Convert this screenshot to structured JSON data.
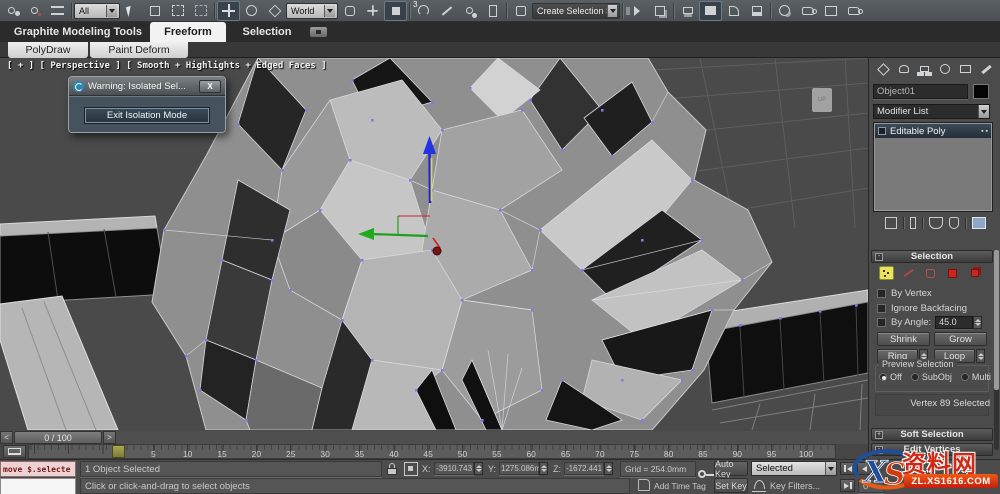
{
  "toolbar": {
    "selection_filter_value": "All",
    "reference_coordinate_value": "World",
    "named_selection_value": "Create Selection Se"
  },
  "ribbon": {
    "tab_gmt": "Graphite Modeling Tools",
    "tab_freeform": "Freeform",
    "tab_selection": "Selection",
    "subtab_polydraw": "PolyDraw",
    "subtab_paintdeform": "Paint Deform"
  },
  "viewport": {
    "label": "[ + ]  [ Perspective ]  [ Smooth + Highlights + Edged Faces ]",
    "up_cube": "UP"
  },
  "dialog": {
    "title": "Warning: Isolated Sel...",
    "close": "X",
    "exit_button": "Exit Isolation Mode"
  },
  "command_panel": {
    "object_name": "Object01",
    "modifier_list": "Modifier List",
    "stack_item": "Editable Poly",
    "selection": {
      "header": "Selection",
      "by_vertex": "By Vertex",
      "ignore_backfacing": "Ignore Backfacing",
      "by_angle": "By Angle:",
      "angle_value": "45.0",
      "shrink": "Shrink",
      "grow": "Grow",
      "ring": "Ring",
      "loop": "Loop",
      "preview_header": "Preview Selection",
      "radio_off": "Off",
      "radio_subobj": "SubObj",
      "radio_multi": "Multi",
      "status": "Vertex 89 Selected"
    },
    "rollout_soft_selection": "Soft Selection",
    "rollout_edit_vertices": "Edit Vertices"
  },
  "timeline": {
    "slider_value": "0 / 100",
    "prev_arrow": "<",
    "next_arrow": ">",
    "ticks": [
      "0",
      "5",
      "10",
      "15",
      "20",
      "25",
      "30",
      "35",
      "40",
      "45",
      "50",
      "55",
      "60",
      "65",
      "70",
      "75",
      "80",
      "85",
      "90",
      "95",
      "100"
    ]
  },
  "status_bar": {
    "maxscript_line": "move $.selecte",
    "selection_status": "1 Object Selected",
    "prompt": "Click or click-and-drag to select objects",
    "x_label": "X:",
    "x_value": "-3910.743",
    "y_label": "Y:",
    "y_value": "1275.086m",
    "z_label": "Z:",
    "z_value": "-1672.441",
    "grid_value": "Grid = 254.0mm",
    "add_time_tag": "Add Time Tag",
    "auto_key": "Auto Key",
    "set_key": "Set Key",
    "key_mode_value": "Selected",
    "key_filters": "Key Filters...",
    "frame_value": "0"
  },
  "watermark": {
    "xs": "XS",
    "site_name": "资料网",
    "site_url": "ZL.XS1616.COM"
  },
  "colors": {
    "vertex_blue": "#7d7de8",
    "subobject_yellow": "#e8e45c",
    "gizmo_blue": "#2222dd",
    "gizmo_green": "#1ca01c",
    "gizmo_red": "#cc2222",
    "watermark_red": "#cf2a18",
    "watermark_blue": "#1f4e9c"
  }
}
